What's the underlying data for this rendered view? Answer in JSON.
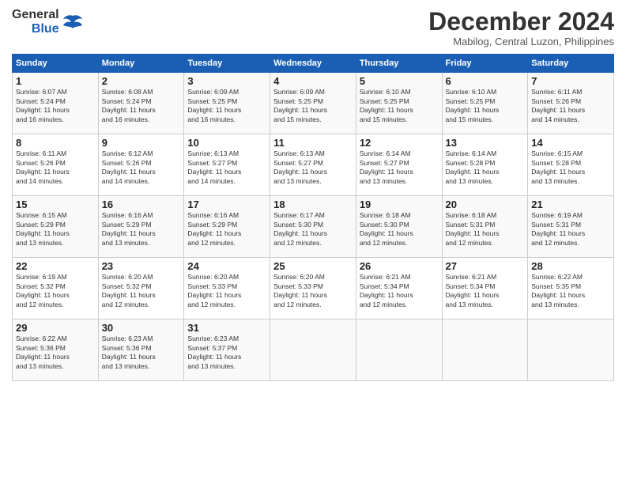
{
  "logo": {
    "line1": "General",
    "line2": "Blue"
  },
  "title": "December 2024",
  "location": "Mabilog, Central Luzon, Philippines",
  "days_header": [
    "Sunday",
    "Monday",
    "Tuesday",
    "Wednesday",
    "Thursday",
    "Friday",
    "Saturday"
  ],
  "weeks": [
    [
      {
        "day": "1",
        "info": "Sunrise: 6:07 AM\nSunset: 5:24 PM\nDaylight: 11 hours\nand 16 minutes."
      },
      {
        "day": "2",
        "info": "Sunrise: 6:08 AM\nSunset: 5:24 PM\nDaylight: 11 hours\nand 16 minutes."
      },
      {
        "day": "3",
        "info": "Sunrise: 6:09 AM\nSunset: 5:25 PM\nDaylight: 11 hours\nand 16 minutes."
      },
      {
        "day": "4",
        "info": "Sunrise: 6:09 AM\nSunset: 5:25 PM\nDaylight: 11 hours\nand 15 minutes."
      },
      {
        "day": "5",
        "info": "Sunrise: 6:10 AM\nSunset: 5:25 PM\nDaylight: 11 hours\nand 15 minutes."
      },
      {
        "day": "6",
        "info": "Sunrise: 6:10 AM\nSunset: 5:25 PM\nDaylight: 11 hours\nand 15 minutes."
      },
      {
        "day": "7",
        "info": "Sunrise: 6:11 AM\nSunset: 5:26 PM\nDaylight: 11 hours\nand 14 minutes."
      }
    ],
    [
      {
        "day": "8",
        "info": "Sunrise: 6:11 AM\nSunset: 5:26 PM\nDaylight: 11 hours\nand 14 minutes."
      },
      {
        "day": "9",
        "info": "Sunrise: 6:12 AM\nSunset: 5:26 PM\nDaylight: 11 hours\nand 14 minutes."
      },
      {
        "day": "10",
        "info": "Sunrise: 6:13 AM\nSunset: 5:27 PM\nDaylight: 11 hours\nand 14 minutes."
      },
      {
        "day": "11",
        "info": "Sunrise: 6:13 AM\nSunset: 5:27 PM\nDaylight: 11 hours\nand 13 minutes."
      },
      {
        "day": "12",
        "info": "Sunrise: 6:14 AM\nSunset: 5:27 PM\nDaylight: 11 hours\nand 13 minutes."
      },
      {
        "day": "13",
        "info": "Sunrise: 6:14 AM\nSunset: 5:28 PM\nDaylight: 11 hours\nand 13 minutes."
      },
      {
        "day": "14",
        "info": "Sunrise: 6:15 AM\nSunset: 5:28 PM\nDaylight: 11 hours\nand 13 minutes."
      }
    ],
    [
      {
        "day": "15",
        "info": "Sunrise: 6:15 AM\nSunset: 5:29 PM\nDaylight: 11 hours\nand 13 minutes."
      },
      {
        "day": "16",
        "info": "Sunrise: 6:16 AM\nSunset: 5:29 PM\nDaylight: 11 hours\nand 13 minutes."
      },
      {
        "day": "17",
        "info": "Sunrise: 6:16 AM\nSunset: 5:29 PM\nDaylight: 11 hours\nand 12 minutes."
      },
      {
        "day": "18",
        "info": "Sunrise: 6:17 AM\nSunset: 5:30 PM\nDaylight: 11 hours\nand 12 minutes."
      },
      {
        "day": "19",
        "info": "Sunrise: 6:18 AM\nSunset: 5:30 PM\nDaylight: 11 hours\nand 12 minutes."
      },
      {
        "day": "20",
        "info": "Sunrise: 6:18 AM\nSunset: 5:31 PM\nDaylight: 11 hours\nand 12 minutes."
      },
      {
        "day": "21",
        "info": "Sunrise: 6:19 AM\nSunset: 5:31 PM\nDaylight: 11 hours\nand 12 minutes."
      }
    ],
    [
      {
        "day": "22",
        "info": "Sunrise: 6:19 AM\nSunset: 5:32 PM\nDaylight: 11 hours\nand 12 minutes."
      },
      {
        "day": "23",
        "info": "Sunrise: 6:20 AM\nSunset: 5:32 PM\nDaylight: 11 hours\nand 12 minutes."
      },
      {
        "day": "24",
        "info": "Sunrise: 6:20 AM\nSunset: 5:33 PM\nDaylight: 11 hours\nand 12 minutes."
      },
      {
        "day": "25",
        "info": "Sunrise: 6:20 AM\nSunset: 5:33 PM\nDaylight: 11 hours\nand 12 minutes."
      },
      {
        "day": "26",
        "info": "Sunrise: 6:21 AM\nSunset: 5:34 PM\nDaylight: 11 hours\nand 12 minutes."
      },
      {
        "day": "27",
        "info": "Sunrise: 6:21 AM\nSunset: 5:34 PM\nDaylight: 11 hours\nand 13 minutes."
      },
      {
        "day": "28",
        "info": "Sunrise: 6:22 AM\nSunset: 5:35 PM\nDaylight: 11 hours\nand 13 minutes."
      }
    ],
    [
      {
        "day": "29",
        "info": "Sunrise: 6:22 AM\nSunset: 5:36 PM\nDaylight: 11 hours\nand 13 minutes."
      },
      {
        "day": "30",
        "info": "Sunrise: 6:23 AM\nSunset: 5:36 PM\nDaylight: 11 hours\nand 13 minutes."
      },
      {
        "day": "31",
        "info": "Sunrise: 6:23 AM\nSunset: 5:37 PM\nDaylight: 11 hours\nand 13 minutes."
      },
      {
        "day": "",
        "info": ""
      },
      {
        "day": "",
        "info": ""
      },
      {
        "day": "",
        "info": ""
      },
      {
        "day": "",
        "info": ""
      }
    ]
  ]
}
